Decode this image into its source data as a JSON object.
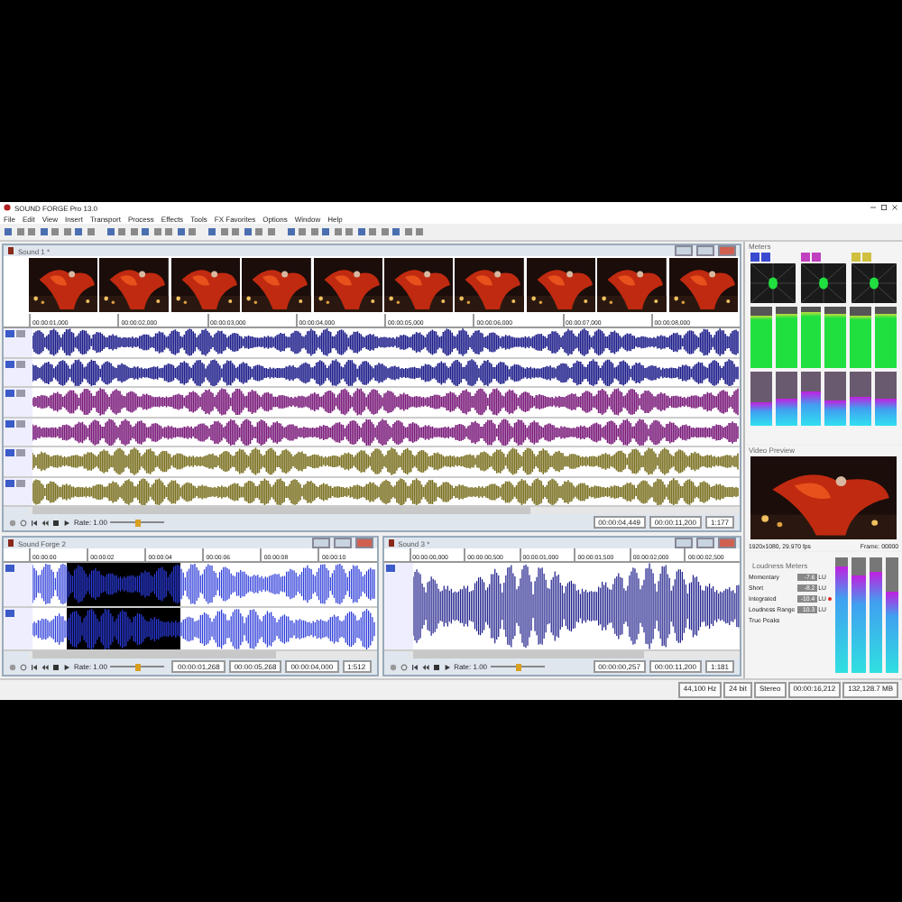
{
  "window": {
    "title": "SOUND FORGE Pro 13.0"
  },
  "menu": [
    "File",
    "Edit",
    "View",
    "Insert",
    "Transport",
    "Process",
    "Effects",
    "Tools",
    "FX Favorites",
    "Options",
    "Window",
    "Help"
  ],
  "main_document": {
    "title": "Sound 1 *",
    "ruler": [
      "00:00:01,000",
      "00:00:02,000",
      "00:00:03,000",
      "00:00:04,000",
      "00:00:05,000",
      "00:00:06,000",
      "00:00:07,000",
      "00:00:08,000"
    ],
    "tracks": [
      {
        "color": "#1c1c8a"
      },
      {
        "color": "#1c1c8a"
      },
      {
        "color": "#7a1a7a"
      },
      {
        "color": "#7a1a7a"
      },
      {
        "color": "#7a7020"
      },
      {
        "color": "#7a7020"
      }
    ],
    "rate": "Rate: 1.00",
    "rate_slider": {
      "level": 0.5
    },
    "position": "00:00:04,449",
    "length": "00:00:11,200",
    "zoom": "1:177"
  },
  "documents": [
    {
      "title": "Sound Forge 2",
      "ruler": [
        "00:00:00",
        "00:00:02",
        "00:00:04",
        "00:00:06",
        "00:00:08",
        "00:00:10"
      ],
      "kind": "stereo",
      "selection": true,
      "rate": "Rate: 1.00",
      "rate_slider": {
        "level": 0.5
      },
      "fields": [
        "00:00:01,268",
        "00:00:05,268",
        "00:00:04,000"
      ],
      "zoom": "1:512"
    },
    {
      "title": "Sound 3 *",
      "ruler": [
        "00:00:00,000",
        "00:00:00,500",
        "00:00:01,000",
        "00:00:01,500",
        "00:00:02,000",
        "00:00:02,500"
      ],
      "kind": "mono",
      "selection": false,
      "rate": "Rate: 1.00",
      "rate_slider": {
        "level": 0.5
      },
      "fields": [
        "00:00:00,257",
        "00:00:11,200"
      ],
      "zoom": "1:181"
    }
  ],
  "meters": {
    "title": "Meters",
    "peaks": [
      {
        "level": 0.86
      },
      {
        "level": 0.88
      },
      {
        "level": 0.9
      },
      {
        "level": 0.87
      },
      {
        "level": 0.85
      },
      {
        "level": 0.88
      }
    ],
    "loudness": [
      {
        "level": 0.45
      },
      {
        "level": 0.5
      },
      {
        "level": 0.62
      },
      {
        "level": 0.48
      },
      {
        "level": 0.55
      },
      {
        "level": 0.5
      }
    ]
  },
  "video": {
    "title": "Video Preview",
    "info": "1920x1080, 29.970 fps",
    "frame": "Frame: 00000"
  },
  "loudness": {
    "title": "Loudness Meters",
    "rows": [
      {
        "label": "Momentary",
        "value": "-7.6",
        "unit": "LU",
        "alert": false
      },
      {
        "label": "Short",
        "value": "-8.2",
        "unit": "LU",
        "alert": false
      },
      {
        "label": "Integrated",
        "value": "-10.4",
        "unit": "LU",
        "alert": true
      },
      {
        "label": "Loudness Range",
        "value": "10.3",
        "unit": "LU",
        "alert": false
      }
    ],
    "true_peaks": "True Peaks",
    "bars": [
      {
        "level": 0.92
      },
      {
        "level": 0.85
      },
      {
        "level": 0.88
      },
      {
        "level": 0.7
      }
    ]
  },
  "status_bar": [
    "44,100 Hz",
    "24 bit",
    "Stereo",
    "00:00:16,212",
    "132,128.7 MB"
  ]
}
